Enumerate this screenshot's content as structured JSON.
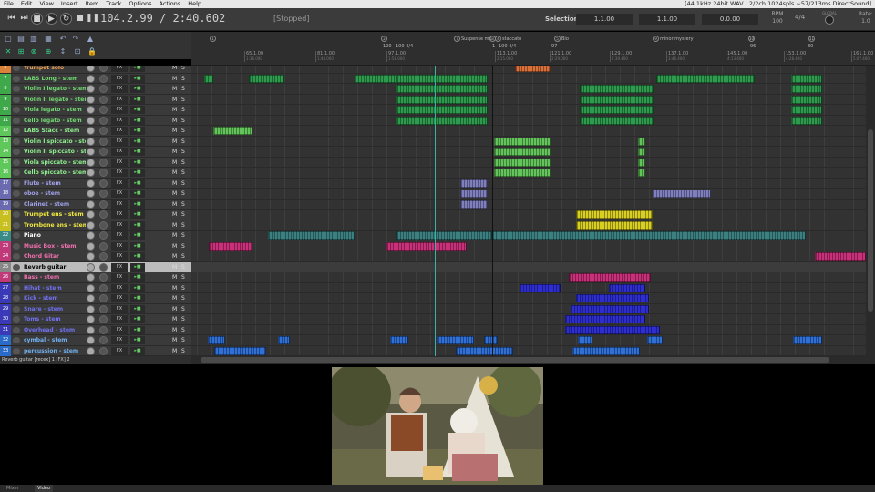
{
  "menu": {
    "items": [
      "File",
      "Edit",
      "View",
      "Insert",
      "Item",
      "Track",
      "Options",
      "Actions",
      "Help"
    ],
    "status": "[44.1kHz 24bit WAV : 2/2ch 1024spls ~57/213ms DirectSound]"
  },
  "transport": {
    "time": "104.2.99 / 2:40.602",
    "state": "[Stopped]",
    "selection_label": "Selection:",
    "sel_start": "1.1.00",
    "sel_end": "1.1.00",
    "sel_len": "0.0.00",
    "bpm_label": "BPM",
    "bpm": "100",
    "timesig": "4/4",
    "rate_label": "Rate:",
    "rate": "1.0",
    "global_label": "GLOBAL"
  },
  "ruler": {
    "markers": [
      {
        "n": "1",
        "label": ""
      },
      {
        "n": "2",
        "label": ""
      },
      {
        "n": "7",
        "label": "Suspense mu"
      },
      {
        "n": "3",
        "label": ""
      },
      {
        "n": "4",
        "label": "staccato"
      },
      {
        "n": "5",
        "label": "Bio"
      },
      {
        "n": "9",
        "label": "minor mystery"
      },
      {
        "n": "10",
        "label": ""
      },
      {
        "n": "11",
        "label": ""
      }
    ],
    "tempos": [
      "120",
      "100 4/4",
      "1",
      "100 4/4",
      "97",
      "96",
      "80"
    ],
    "bars": [
      {
        "bar": "65.1.00",
        "time": "1:36.000"
      },
      {
        "bar": "81.1.00",
        "time": "1:48.000"
      },
      {
        "bar": "97.1.00",
        "time": "1:58.000"
      },
      {
        "bar": "113.1.00",
        "time": "2:15.000"
      },
      {
        "bar": "121.1.00",
        "time": "2:29.000"
      },
      {
        "bar": "129.1.00",
        "time": "2:39.400"
      },
      {
        "bar": "137.1.00",
        "time": "3:46.400"
      },
      {
        "bar": "145.1.00",
        "time": "4:13.400"
      },
      {
        "bar": "153.1.00",
        "time": "4:28.400"
      },
      {
        "bar": "161.1.00",
        "time": "5:07.400"
      }
    ]
  },
  "tracks": [
    {
      "num": "6",
      "name": "Trumpet solo",
      "color": "#d9823a",
      "namecolor": "#f0a050"
    },
    {
      "num": "7",
      "name": "LABS Long - stem",
      "color": "#3fa84a",
      "namecolor": "#70d870"
    },
    {
      "num": "8",
      "name": "Violin I legato - stem",
      "color": "#3fa84a",
      "namecolor": "#70d870"
    },
    {
      "num": "9",
      "name": "Violin II legato - stem",
      "color": "#3fa84a",
      "namecolor": "#70d870"
    },
    {
      "num": "10",
      "name": "Viola legato - stem",
      "color": "#3fa84a",
      "namecolor": "#70d870"
    },
    {
      "num": "11",
      "name": "Cello legato - stem",
      "color": "#3fa84a",
      "namecolor": "#70d870"
    },
    {
      "num": "12",
      "name": "LABS Stacc - stem",
      "color": "#5fc85a",
      "namecolor": "#8ef08e"
    },
    {
      "num": "13",
      "name": "Violin I spiccato - sten",
      "color": "#5fc85a",
      "namecolor": "#8ef08e"
    },
    {
      "num": "14",
      "name": "Violin II spiccato - ster",
      "color": "#5fc85a",
      "namecolor": "#8ef08e"
    },
    {
      "num": "15",
      "name": "Viola spiccato - stem",
      "color": "#5fc85a",
      "namecolor": "#8ef08e"
    },
    {
      "num": "16",
      "name": "Cello spiccato - stem",
      "color": "#5fc85a",
      "namecolor": "#8ef08e"
    },
    {
      "num": "17",
      "name": "Flute - stem",
      "color": "#6a6ab0",
      "namecolor": "#a0a0e8"
    },
    {
      "num": "18",
      "name": "oboe - stem",
      "color": "#6a6ab0",
      "namecolor": "#a0a0e8"
    },
    {
      "num": "19",
      "name": "Clarinet - stem",
      "color": "#6a6ab0",
      "namecolor": "#a0a0e8"
    },
    {
      "num": "20",
      "name": "Trumpet ens - stem",
      "color": "#c8c020",
      "namecolor": "#f0e840"
    },
    {
      "num": "21",
      "name": "Trombone ens - stem",
      "color": "#c8c020",
      "namecolor": "#f0e840"
    },
    {
      "num": "22",
      "name": "Piano",
      "color": "#3a8a88",
      "namecolor": "#ffffff"
    },
    {
      "num": "23",
      "name": "Music Box - stem",
      "color": "#c03a7a",
      "namecolor": "#f070b0"
    },
    {
      "num": "24",
      "name": "Chord Gitar",
      "color": "#c03a7a",
      "namecolor": "#f070b0"
    },
    {
      "num": "25",
      "name": "Reverb guitar",
      "color": "#888888",
      "namecolor": "#000000",
      "selected": true
    },
    {
      "num": "26",
      "name": "Bass - stem",
      "color": "#c03a7a",
      "namecolor": "#f070b0"
    },
    {
      "num": "27",
      "name": "Hihat - stem",
      "color": "#3a3ab8",
      "namecolor": "#7070f0"
    },
    {
      "num": "28",
      "name": "Kick - stem",
      "color": "#3a3ab8",
      "namecolor": "#7070f0"
    },
    {
      "num": "29",
      "name": "Snare - stem",
      "color": "#3a3ab8",
      "namecolor": "#7070f0"
    },
    {
      "num": "30",
      "name": "Toms - stem",
      "color": "#3a3ab8",
      "namecolor": "#7070f0"
    },
    {
      "num": "31",
      "name": "Overhead - stem",
      "color": "#3a3ab8",
      "namecolor": "#7070f0"
    },
    {
      "num": "32",
      "name": "cymbal - stem",
      "color": "#2a6ac8",
      "namecolor": "#70b0f0"
    },
    {
      "num": "33",
      "name": "percussion - stem",
      "color": "#2a6ac8",
      "namecolor": "#70b0f0"
    }
  ],
  "track_buttons": {
    "fx": "FX",
    "mute": "M",
    "solo": "S"
  },
  "statusline": "Reverb guitar [recex] 1 [FX] 2",
  "dock_tabs": [
    "Mixer",
    "Video"
  ],
  "colors": {
    "green_legato": "#2e9a4e",
    "green_stacc": "#62c45a",
    "purple": "#7f7fbf",
    "yellow": "#d8cf22",
    "teal": "#3b7f80",
    "pink": "#c8307a",
    "blue": "#2d2dd0",
    "lightblue": "#2f6fd6",
    "orange": "#d9703a"
  }
}
